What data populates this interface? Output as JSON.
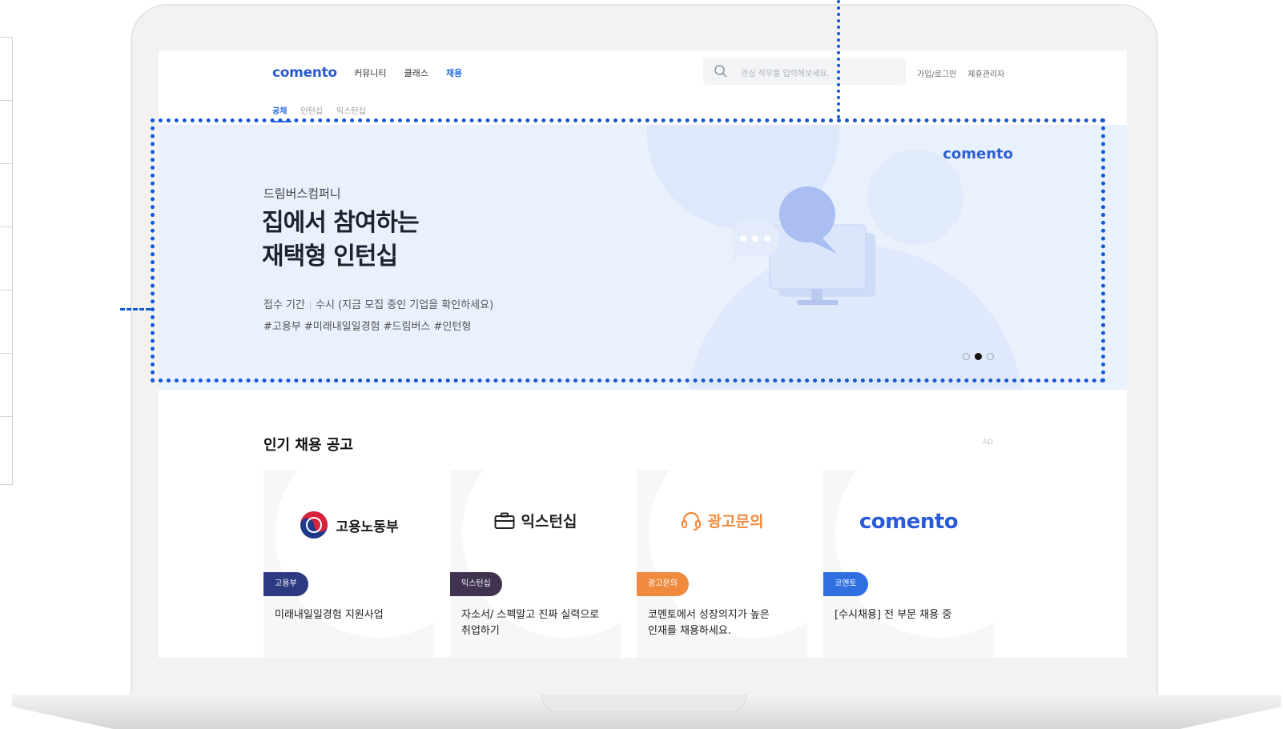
{
  "header": {
    "logo": "comento",
    "nav": [
      "커뮤니티",
      "클래스",
      "채용"
    ],
    "search_placeholder": "관심 직무를 입력해보세요.",
    "links": [
      "가입/로그인",
      "제휴관리자"
    ]
  },
  "subnav": [
    "공채",
    "인턴십",
    "익스턴십"
  ],
  "banner": {
    "brand": "comento",
    "company": "드림버스컴퍼니",
    "headline_line1": "집에서 참여하는",
    "headline_line2": "재택형 인턴십",
    "period_label": "접수 기간",
    "period_value": "수시 (지금 모집 중인 기업을 확인하세요)",
    "tags": "#고용부 #미래내일일경험 #드림버스 #인턴형",
    "slide_count": 3,
    "active_slide": 2
  },
  "popular": {
    "title": "인기 채용 공고",
    "ad_label": "AD",
    "cards": [
      {
        "logo": "고용노동부",
        "tag": "고용부",
        "title": "미래내일일경험 지원사업",
        "tag_color": "#2e3a80"
      },
      {
        "logo": "익스턴십",
        "tag": "익스턴십",
        "title_line1": "자소서/ 스펙말고 진짜 실력으로",
        "title_line2": "취업하기",
        "tag_color": "#3f3350"
      },
      {
        "logo": "광고문의",
        "tag": "광고문의",
        "title_line1": "코멘토에서 성장의지가 높은",
        "title_line2": "인재를 채용하세요.",
        "tag_color": "#f08a3e"
      },
      {
        "logo": "comento",
        "tag": "코멘토",
        "title": "[수시채용] 전 부문 채용 중",
        "tag_color": "#2f6fe0"
      }
    ]
  },
  "colors": {
    "accent": "#2a5bd7",
    "highlight": "#1458d6",
    "banner_bg": "#e9f1fd"
  }
}
